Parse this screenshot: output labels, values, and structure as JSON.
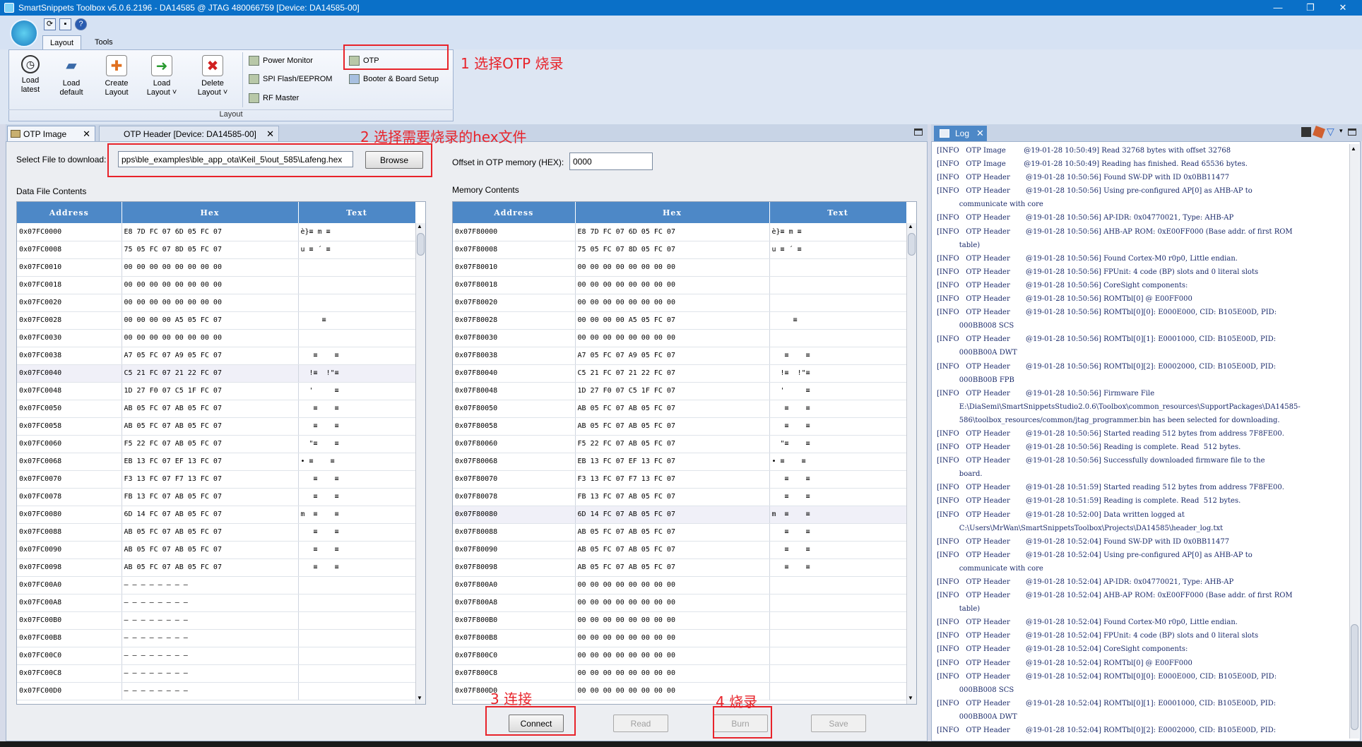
{
  "window": {
    "title": "SmartSnippets Toolbox v5.0.6.2196 - DA14585 @ JTAG 480066759 [Device: DA14585-00]",
    "minimize": "—",
    "restore": "❐",
    "close": "✕"
  },
  "ribbon": {
    "tabs": [
      "Layout",
      "Tools"
    ],
    "big_buttons": [
      {
        "label": "Load\nlatest",
        "icon": "clock-icon"
      },
      {
        "label": "Load\ndefault",
        "icon": "folder-icon"
      },
      {
        "label": "Create\nLayout",
        "icon": "document-add-icon"
      },
      {
        "label": "Load\nLayout ˅",
        "icon": "load-arrow-icon"
      },
      {
        "label": "Delete\nLayout ˅",
        "icon": "delete-icon"
      }
    ],
    "small_col1": [
      "Power Monitor",
      "SPI Flash/EEPROM",
      "RF Master"
    ],
    "small_col2": [
      "OTP",
      "Booter & Board Setup"
    ],
    "group_label": "Layout"
  },
  "doc_tabs": {
    "otp_image": "OTP Image",
    "otp_header": "OTP Header [Device: DA14585-00]",
    "close": "✕"
  },
  "otp": {
    "select_label": "Select File to download:",
    "file_value": "pps\\ble_examples\\ble_app_ota\\Keil_5\\out_585\\Lafeng.hex",
    "browse": "Browse",
    "offset_label": "Offset in OTP memory (HEX):",
    "offset_value": "0000",
    "data_file_title": "Data File Contents",
    "memory_title": "Memory Contents",
    "columns": [
      "Address",
      "Hex",
      "Text"
    ],
    "data_rows": [
      [
        "0x07FC0000",
        "E8 7D FC 07 6D 05 FC 07",
        "è}≡ m ≡"
      ],
      [
        "0x07FC0008",
        "75 05 FC 07 8D 05 FC 07",
        "u ≡ ´ ≡"
      ],
      [
        "0x07FC0010",
        "00 00 00 00 00 00 00 00",
        ""
      ],
      [
        "0x07FC0018",
        "00 00 00 00 00 00 00 00",
        ""
      ],
      [
        "0x07FC0020",
        "00 00 00 00 00 00 00 00",
        ""
      ],
      [
        "0x07FC0028",
        "00 00 00 00 A5 05 FC 07",
        "     ≡"
      ],
      [
        "0x07FC0030",
        "00 00 00 00 00 00 00 00",
        ""
      ],
      [
        "0x07FC0038",
        "A7 05 FC 07 A9 05 FC 07",
        "   ≡    ≡"
      ],
      [
        "0x07FC0040",
        "C5 21 FC 07 21 22 FC 07",
        "  !≡  !\"≡"
      ],
      [
        "0x07FC0048",
        "1D 27 F0 07 C5 1F FC 07",
        "  '     ≡"
      ],
      [
        "0x07FC0050",
        "AB 05 FC 07 AB 05 FC 07",
        "   ≡    ≡"
      ],
      [
        "0x07FC0058",
        "AB 05 FC 07 AB 05 FC 07",
        "   ≡    ≡"
      ],
      [
        "0x07FC0060",
        "F5 22 FC 07 AB 05 FC 07",
        "  \"≡    ≡"
      ],
      [
        "0x07FC0068",
        "EB 13 FC 07 EF 13 FC 07",
        "• ≡    ≡"
      ],
      [
        "0x07FC0070",
        "F3 13 FC 07 F7 13 FC 07",
        "   ≡    ≡"
      ],
      [
        "0x07FC0078",
        "FB 13 FC 07 AB 05 FC 07",
        "   ≡    ≡"
      ],
      [
        "0x07FC0080",
        "6D 14 FC 07 AB 05 FC 07",
        "m  ≡    ≡"
      ],
      [
        "0x07FC0088",
        "AB 05 FC 07 AB 05 FC 07",
        "   ≡    ≡"
      ],
      [
        "0x07FC0090",
        "AB 05 FC 07 AB 05 FC 07",
        "   ≡    ≡"
      ],
      [
        "0x07FC0098",
        "AB 05 FC 07 AB 05 FC 07",
        "   ≡    ≡"
      ],
      [
        "0x07FC00A0",
        "— — — — — — — —",
        ""
      ],
      [
        "0x07FC00A8",
        "— — — — — — — —",
        ""
      ],
      [
        "0x07FC00B0",
        "— — — — — — — —",
        ""
      ],
      [
        "0x07FC00B8",
        "— — — — — — — —",
        ""
      ],
      [
        "0x07FC00C0",
        "— — — — — — — —",
        ""
      ],
      [
        "0x07FC00C8",
        "— — — — — — — —",
        ""
      ],
      [
        "0x07FC00D0",
        "— — — — — — — —",
        ""
      ]
    ],
    "mem_rows": [
      [
        "0x07F80000",
        "E8 7D FC 07 6D 05 FC 07",
        "è}≡ m ≡"
      ],
      [
        "0x07F80008",
        "75 05 FC 07 8D 05 FC 07",
        "u ≡ ´ ≡"
      ],
      [
        "0x07F80010",
        "00 00 00 00 00 00 00 00",
        ""
      ],
      [
        "0x07F80018",
        "00 00 00 00 00 00 00 00",
        ""
      ],
      [
        "0x07F80020",
        "00 00 00 00 00 00 00 00",
        ""
      ],
      [
        "0x07F80028",
        "00 00 00 00 A5 05 FC 07",
        "     ≡"
      ],
      [
        "0x07F80030",
        "00 00 00 00 00 00 00 00",
        ""
      ],
      [
        "0x07F80038",
        "A7 05 FC 07 A9 05 FC 07",
        "   ≡    ≡"
      ],
      [
        "0x07F80040",
        "C5 21 FC 07 21 22 FC 07",
        "  !≡  !\"≡"
      ],
      [
        "0x07F80048",
        "1D 27 F0 07 C5 1F FC 07",
        "  '     ≡"
      ],
      [
        "0x07F80050",
        "AB 05 FC 07 AB 05 FC 07",
        "   ≡    ≡"
      ],
      [
        "0x07F80058",
        "AB 05 FC 07 AB 05 FC 07",
        "   ≡    ≡"
      ],
      [
        "0x07F80060",
        "F5 22 FC 07 AB 05 FC 07",
        "  \"≡    ≡"
      ],
      [
        "0x07F80068",
        "EB 13 FC 07 EF 13 FC 07",
        "• ≡    ≡"
      ],
      [
        "0x07F80070",
        "F3 13 FC 07 F7 13 FC 07",
        "   ≡    ≡"
      ],
      [
        "0x07F80078",
        "FB 13 FC 07 AB 05 FC 07",
        "   ≡    ≡"
      ],
      [
        "0x07F80080",
        "6D 14 FC 07 AB 05 FC 07",
        "m  ≡    ≡"
      ],
      [
        "0x07F80088",
        "AB 05 FC 07 AB 05 FC 07",
        "   ≡    ≡"
      ],
      [
        "0x07F80090",
        "AB 05 FC 07 AB 05 FC 07",
        "   ≡    ≡"
      ],
      [
        "0x07F80098",
        "AB 05 FC 07 AB 05 FC 07",
        "   ≡    ≡"
      ],
      [
        "0x07F800A0",
        "00 00 00 00 00 00 00 00",
        ""
      ],
      [
        "0x07F800A8",
        "00 00 00 00 00 00 00 00",
        ""
      ],
      [
        "0x07F800B0",
        "00 00 00 00 00 00 00 00",
        ""
      ],
      [
        "0x07F800B8",
        "00 00 00 00 00 00 00 00",
        ""
      ],
      [
        "0x07F800C0",
        "00 00 00 00 00 00 00 00",
        ""
      ],
      [
        "0x07F800C8",
        "00 00 00 00 00 00 00 00",
        ""
      ],
      [
        "0x07F800D0",
        "00 00 00 00 00 00 00 00",
        ""
      ]
    ],
    "buttons": {
      "connect": "Connect",
      "read": "Read",
      "burn": "Burn",
      "save": "Save"
    }
  },
  "log": {
    "tab": "Log",
    "lines": [
      "[INFO   OTP Image        @19-01-28 10:50:49] Read 32768 bytes with offset 32768",
      "[INFO   OTP Image        @19-01-28 10:50:49] Reading has finished. Read 65536 bytes.",
      "[INFO   OTP Header       @19-01-28 10:50:56] Found SW-DP with ID 0x0BB11477",
      "[INFO   OTP Header       @19-01-28 10:50:56] Using pre-configured AP[0] as AHB-AP to",
      "          communicate with core",
      "[INFO   OTP Header       @19-01-28 10:50:56] AP-IDR: 0x04770021, Type: AHB-AP",
      "[INFO   OTP Header       @19-01-28 10:50:56] AHB-AP ROM: 0xE00FF000 (Base addr. of first ROM",
      "          table)",
      "[INFO   OTP Header       @19-01-28 10:50:56] Found Cortex-M0 r0p0, Little endian.",
      "[INFO   OTP Header       @19-01-28 10:50:56] FPUnit: 4 code (BP) slots and 0 literal slots",
      "[INFO   OTP Header       @19-01-28 10:50:56] CoreSight components:",
      "[INFO   OTP Header       @19-01-28 10:50:56] ROMTbl[0] @ E00FF000",
      "[INFO   OTP Header       @19-01-28 10:50:56] ROMTbl[0][0]: E000E000, CID: B105E00D, PID:",
      "          000BB008 SCS",
      "[INFO   OTP Header       @19-01-28 10:50:56] ROMTbl[0][1]: E0001000, CID: B105E00D, PID:",
      "          000BB00A DWT",
      "[INFO   OTP Header       @19-01-28 10:50:56] ROMTbl[0][2]: E0002000, CID: B105E00D, PID:",
      "          000BB00B FPB",
      "[INFO   OTP Header       @19-01-28 10:50:56] Firmware File",
      "          E:\\DiaSemi\\SmartSnippetsStudio2.0.6\\Toolbox\\common_resources\\SupportPackages\\DA14585-",
      "          586\\toolbox_resources/common/jtag_programmer.bin has been selected for downloading.",
      "[INFO   OTP Header       @19-01-28 10:50:56] Started reading 512 bytes from address 7F8FE00.",
      "[INFO   OTP Header       @19-01-28 10:50:56] Reading is complete. Read  512 bytes.",
      "[INFO   OTP Header       @19-01-28 10:50:56] Successfully downloaded firmware file to the",
      "          board.",
      "[INFO   OTP Header       @19-01-28 10:51:59] Started reading 512 bytes from address 7F8FE00.",
      "[INFO   OTP Header       @19-01-28 10:51:59] Reading is complete. Read  512 bytes.",
      "[INFO   OTP Header       @19-01-28 10:52:00] Data written logged at",
      "          C:\\Users\\MrWan\\SmartSnippetsToolbox\\Projects\\DA14585\\header_log.txt",
      "[INFO   OTP Header       @19-01-28 10:52:04] Found SW-DP with ID 0x0BB11477",
      "[INFO   OTP Header       @19-01-28 10:52:04] Using pre-configured AP[0] as AHB-AP to",
      "          communicate with core",
      "[INFO   OTP Header       @19-01-28 10:52:04] AP-IDR: 0x04770021, Type: AHB-AP",
      "[INFO   OTP Header       @19-01-28 10:52:04] AHB-AP ROM: 0xE00FF000 (Base addr. of first ROM",
      "          table)",
      "[INFO   OTP Header       @19-01-28 10:52:04] Found Cortex-M0 r0p0, Little endian.",
      "[INFO   OTP Header       @19-01-28 10:52:04] FPUnit: 4 code (BP) slots and 0 literal slots",
      "[INFO   OTP Header       @19-01-28 10:52:04] CoreSight components:",
      "[INFO   OTP Header       @19-01-28 10:52:04] ROMTbl[0] @ E00FF000",
      "[INFO   OTP Header       @19-01-28 10:52:04] ROMTbl[0][0]: E000E000, CID: B105E00D, PID:",
      "          000BB008 SCS",
      "[INFO   OTP Header       @19-01-28 10:52:04] ROMTbl[0][1]: E0001000, CID: B105E00D, PID:",
      "          000BB00A DWT",
      "[INFO   OTP Header       @19-01-28 10:52:04] ROMTbl[0][2]: E0002000, CID: B105E00D, PID:"
    ]
  },
  "annotations": {
    "step1": "1 选择OTP 烧录",
    "step2": "2 选择需要烧录的hex文件",
    "step3": "3 连接",
    "step4": "4 烧录",
    "color": "#e8232a"
  }
}
